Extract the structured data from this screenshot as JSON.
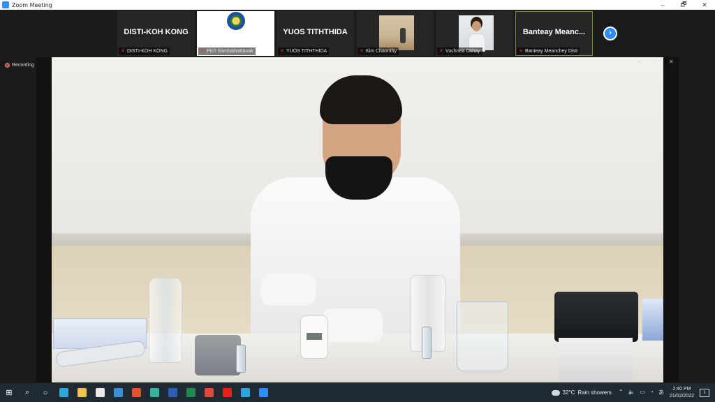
{
  "window": {
    "title": "Zoom Meeting",
    "controls": {
      "minimize": "–",
      "maximize": "🗗",
      "close": "✕"
    }
  },
  "participants_strip": {
    "tiles": [
      {
        "display_name": "DISTI-KOH KONG",
        "label": "DISTI-KOH KONG",
        "muted": true,
        "kind": "name"
      },
      {
        "display_name": "",
        "label": "Pich Sambattrattanak",
        "muted": true,
        "kind": "logo"
      },
      {
        "display_name": "YUOS TITHTHIDA",
        "label": "YUOS TITHTHIDA",
        "muted": true,
        "kind": "name"
      },
      {
        "display_name": "",
        "label": "Kim Channthy",
        "muted": true,
        "kind": "room"
      },
      {
        "display_name": "",
        "label": "Vuchnea Chhay",
        "muted": true,
        "kind": "person"
      },
      {
        "display_name": "Banteay Meanc...",
        "label": "Banteay Meanchey Disti",
        "muted": true,
        "kind": "name",
        "active_speaker": true
      }
    ],
    "next_page_icon": "›"
  },
  "recording": {
    "label": "Recording"
  },
  "shared_video": {
    "controls": {
      "minimize": "–",
      "restore": "▫",
      "close": "✕"
    },
    "description_icons": [
      "presenter",
      "lab-equipment"
    ]
  },
  "taskbar": {
    "apps": [
      {
        "name": "windows-start",
        "glyph": "⊞",
        "color": "#ffffff"
      },
      {
        "name": "search",
        "glyph": "⌕",
        "color": "#ffffff"
      },
      {
        "name": "task-view",
        "glyph": "○",
        "color": "#ffffff"
      },
      {
        "name": "edge",
        "color": "#2fa5d8"
      },
      {
        "name": "file-explorer",
        "color": "#f2c14e"
      },
      {
        "name": "store",
        "color": "#e8e8e8"
      },
      {
        "name": "mail",
        "color": "#3a8fd8"
      },
      {
        "name": "office",
        "color": "#e0552b"
      },
      {
        "name": "snip",
        "color": "#36b3a0"
      },
      {
        "name": "word",
        "color": "#2b5fb8"
      },
      {
        "name": "excel",
        "color": "#1f8a4c"
      },
      {
        "name": "chrome",
        "color": "#e04a3a"
      },
      {
        "name": "youtube",
        "color": "#e62117"
      },
      {
        "name": "telegram",
        "color": "#2ea6dc"
      },
      {
        "name": "zoom",
        "color": "#2d8cff"
      }
    ],
    "weather": {
      "temp": "32°C",
      "condition": "Rain showers"
    },
    "system_icons": [
      "⌃",
      "🔈",
      "▭",
      "◔",
      "あ"
    ],
    "clock": {
      "time": "2:40 PM",
      "date": "21/02/2022"
    },
    "notifications": "1"
  }
}
